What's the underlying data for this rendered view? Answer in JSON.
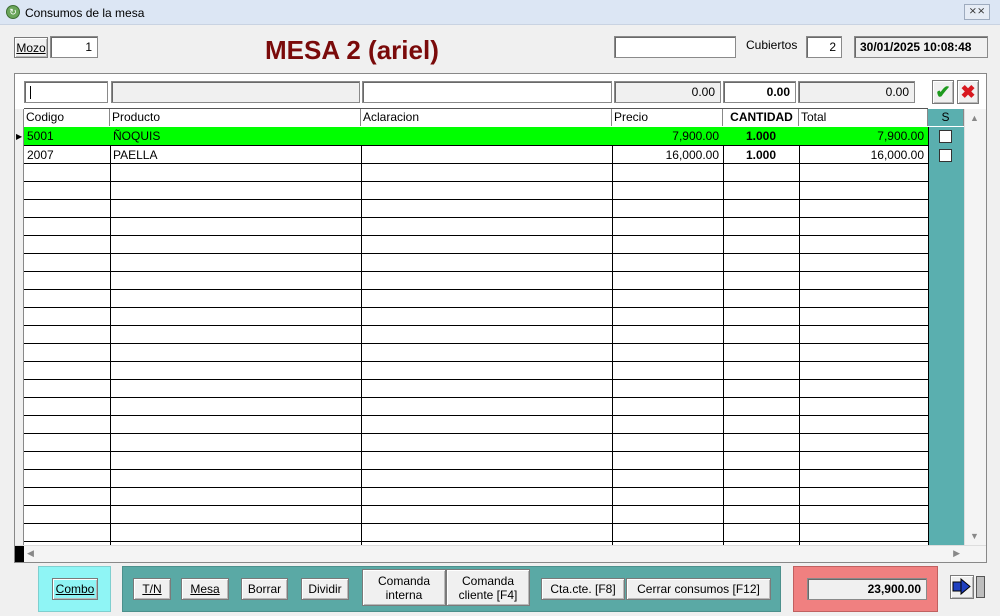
{
  "window": {
    "title": "Consumos de la mesa",
    "close_label": "⨯⨯"
  },
  "header": {
    "mozo_label": "Mozo",
    "mozo_value": "1",
    "mesa_title": "MESA 2 (ariel)",
    "search_value": "",
    "cubiertos_label": "Cubiertos",
    "cubiertos_value": "2",
    "datetime": "30/01/2025 10:08:48"
  },
  "filter": {
    "codigo": "",
    "producto": "",
    "aclaracion": "",
    "precio": "0.00",
    "cantidad": "0.00",
    "total": "0.00",
    "accept_icon": "check-icon",
    "cancel_icon": "x-icon"
  },
  "grid": {
    "columns": [
      "Codigo",
      "Producto",
      "Aclaracion",
      "Precio",
      "CANTIDAD",
      "Total",
      "S"
    ],
    "rows": [
      {
        "codigo": "5001",
        "producto": "ÑOQUIS",
        "aclaracion": "",
        "precio": "7,900.00",
        "cantidad": "1.000",
        "total": "7,900.00",
        "s": false,
        "selected": true
      },
      {
        "codigo": "2007",
        "producto": "PAELLA",
        "aclaracion": "",
        "precio": "16,000.00",
        "cantidad": "1.000",
        "total": "16,000.00",
        "s": false,
        "selected": false
      }
    ]
  },
  "footer": {
    "combo": "Combo",
    "tn": "T/N",
    "mesa": "Mesa",
    "borrar": "Borrar",
    "dividir": "Dividir",
    "comanda_interna_1": "Comanda",
    "comanda_interna_2": "interna",
    "comanda_cliente_1": "Comanda",
    "comanda_cliente_2": "cliente [F4]",
    "ctacte": "Cta.cte. [F8]",
    "cerrar": "Cerrar consumos [F12]",
    "total": "23,900.00",
    "exit_icon": "exit-door-icon"
  },
  "colors": {
    "selected_row": "#00ff00",
    "s_column": "#5aafaf",
    "footer_panel": "#5aa9a5",
    "combo_panel": "#8ff5f5",
    "total_panel": "#f08080",
    "title": "#7a0a0a"
  }
}
